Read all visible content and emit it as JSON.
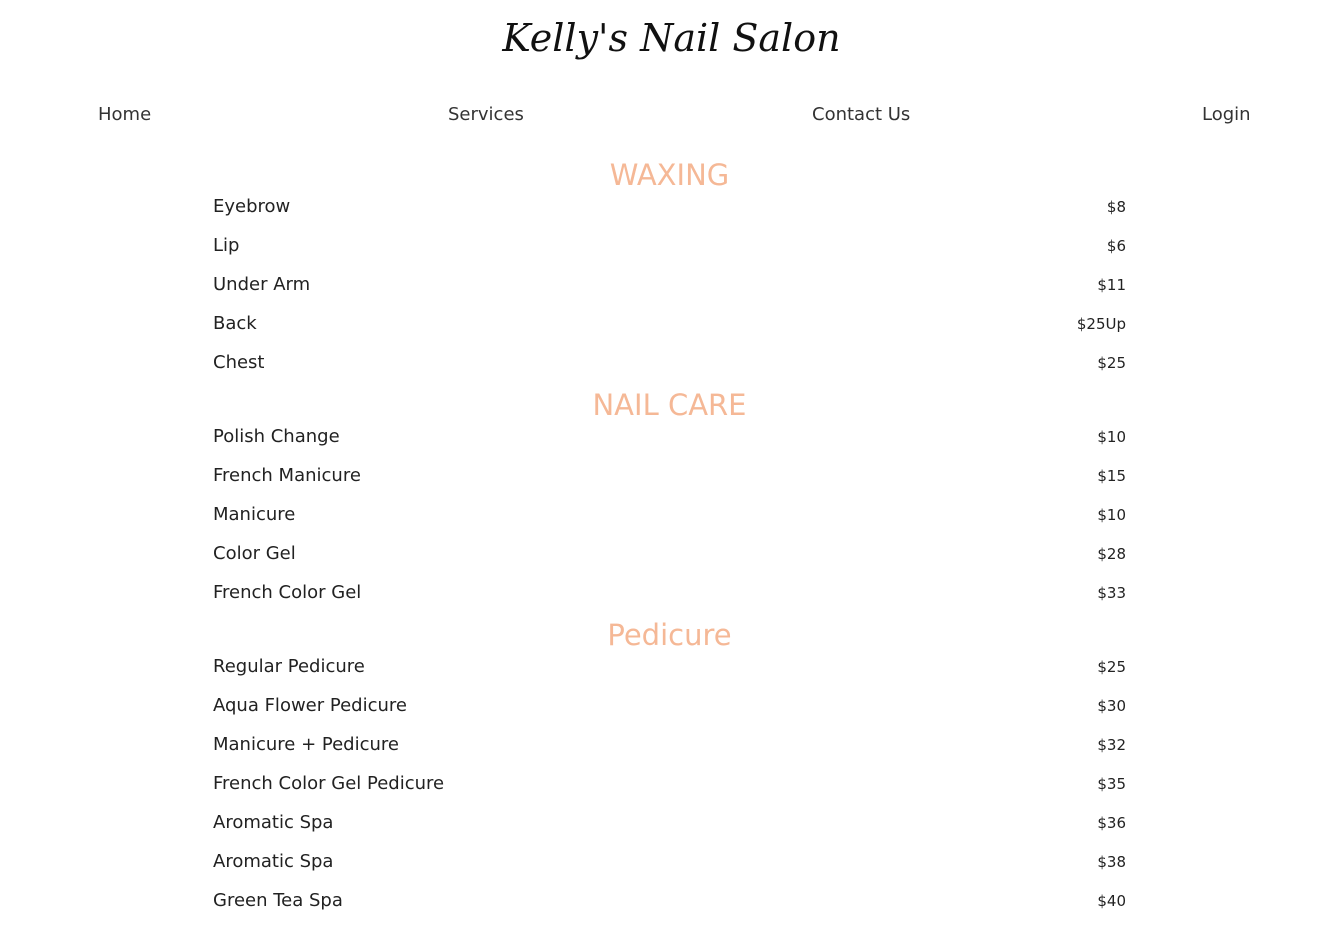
{
  "header": {
    "title": "Kelly's Nail Salon"
  },
  "nav": {
    "home": "Home",
    "services": "Services",
    "contact": "Contact Us",
    "login": "Login"
  },
  "colors": {
    "section_title": "#f5b896",
    "text": "#222222"
  },
  "sections": [
    {
      "title": "WAXING",
      "items": [
        {
          "name": "Eyebrow",
          "price": "$8"
        },
        {
          "name": "Lip",
          "price": "$6"
        },
        {
          "name": "Under Arm",
          "price": "$11"
        },
        {
          "name": "Back",
          "price": "$25Up"
        },
        {
          "name": "Chest",
          "price": "$25"
        }
      ]
    },
    {
      "title": "NAIL CARE",
      "items": [
        {
          "name": "Polish Change",
          "price": "$10"
        },
        {
          "name": "French Manicure",
          "price": "$15"
        },
        {
          "name": "Manicure",
          "price": "$10"
        },
        {
          "name": "Color Gel",
          "price": "$28"
        },
        {
          "name": "French Color Gel",
          "price": "$33"
        }
      ]
    },
    {
      "title": "Pedicure",
      "items": [
        {
          "name": "Regular Pedicure",
          "price": "$25"
        },
        {
          "name": "Aqua Flower Pedicure",
          "price": "$30"
        },
        {
          "name": "Manicure + Pedicure",
          "price": "$32"
        },
        {
          "name": "French Color Gel Pedicure",
          "price": "$35"
        },
        {
          "name": "Aromatic Spa",
          "price": "$36"
        },
        {
          "name": "Aromatic Spa",
          "price": "$38"
        },
        {
          "name": "Green Tea Spa",
          "price": "$40"
        }
      ]
    }
  ]
}
